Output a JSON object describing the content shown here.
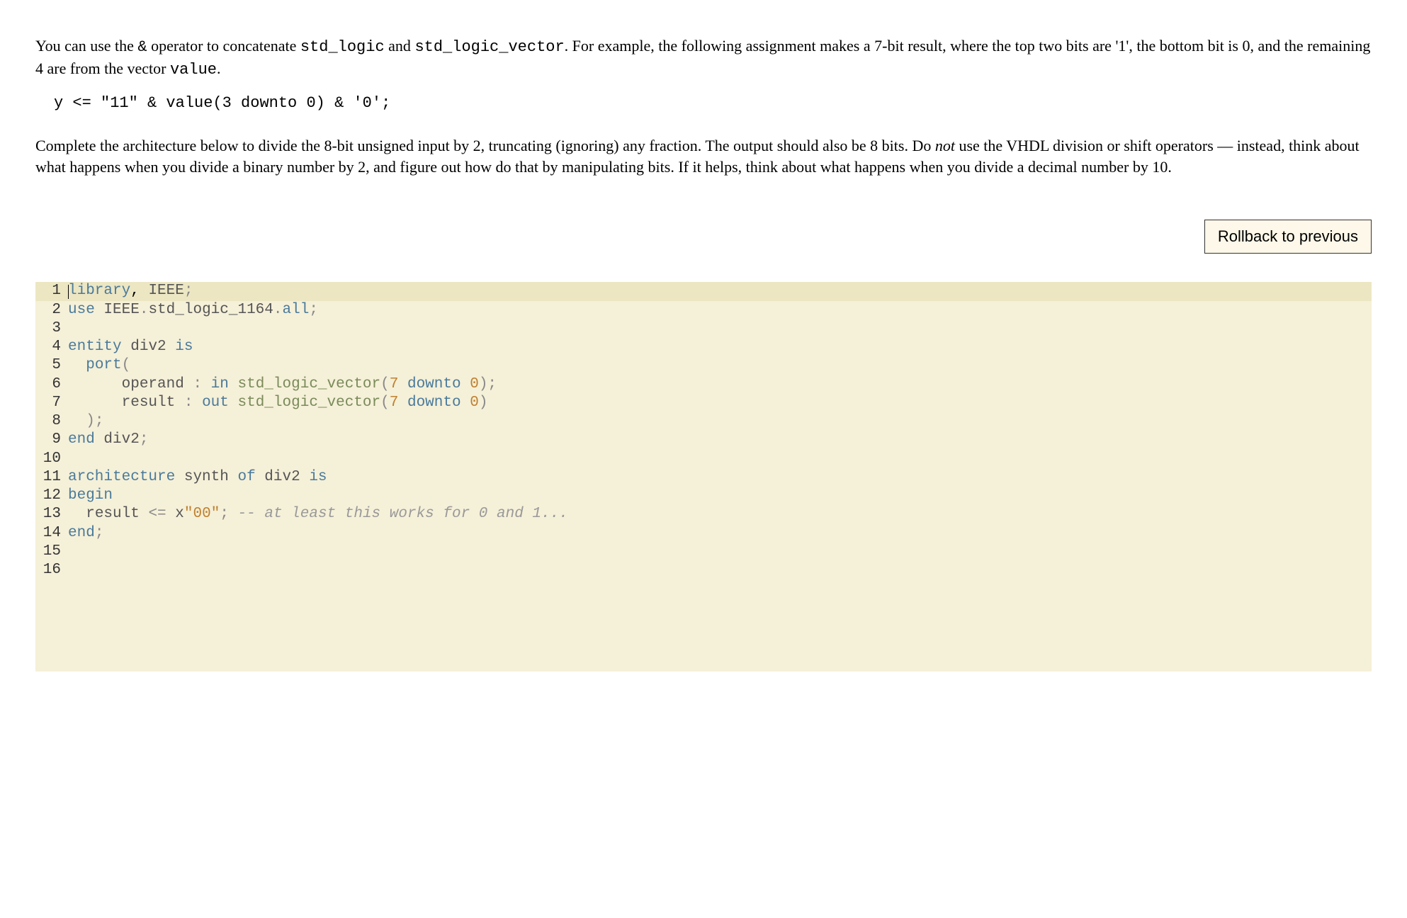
{
  "prose": {
    "para1_part1": "You can use the ",
    "para1_code1": "&",
    "para1_part2": " operator to concatenate ",
    "para1_code2": "std_logic",
    "para1_part3": " and ",
    "para1_code3": "std_logic_vector",
    "para1_part4": ". For example, the following assignment makes a 7-bit result, where the top two bits are '1', the bottom bit is 0, and the remaining 4 are from the vector ",
    "para1_code4": "value",
    "para1_part5": ".",
    "code_block": "y <= \"11\" & value(3 downto 0) & '0';",
    "para2_part1": "Complete the architecture below to divide the 8-bit unsigned input by 2, truncating (ignoring) any fraction. The output should also be 8 bits. Do ",
    "para2_em": "not",
    "para2_part2": " use the VHDL division or shift operators — instead, think about what happens when you divide a binary number by 2, and figure out how do that by manipulating bits. If it helps, think about what happens when you divide a decimal number by 10."
  },
  "button": {
    "rollback": "Rollback to previous"
  },
  "editor": {
    "lines": [
      {
        "n": "1",
        "tokens": [
          [
            "cursor",
            ""
          ],
          [
            "kw",
            "library"
          ],
          [
            "",
            ", "
          ],
          [
            "id",
            "IEEE"
          ],
          [
            "punc",
            ";"
          ]
        ]
      },
      {
        "n": "2",
        "tokens": [
          [
            "kw",
            "use"
          ],
          [
            "",
            " "
          ],
          [
            "id",
            "IEEE"
          ],
          [
            "punc",
            "."
          ],
          [
            "id",
            "std_logic_1164"
          ],
          [
            "punc",
            "."
          ],
          [
            "kw",
            "all"
          ],
          [
            "punc",
            ";"
          ]
        ]
      },
      {
        "n": "3",
        "tokens": [
          [
            "",
            ""
          ]
        ]
      },
      {
        "n": "4",
        "tokens": [
          [
            "kw",
            "entity"
          ],
          [
            "",
            " "
          ],
          [
            "id",
            "div2"
          ],
          [
            "",
            " "
          ],
          [
            "kw",
            "is"
          ]
        ]
      },
      {
        "n": "5",
        "tokens": [
          [
            "",
            "  "
          ],
          [
            "kw",
            "port"
          ],
          [
            "punc",
            "("
          ]
        ]
      },
      {
        "n": "6",
        "tokens": [
          [
            "",
            "      "
          ],
          [
            "id",
            "operand"
          ],
          [
            "",
            " "
          ],
          [
            "punc",
            ":"
          ],
          [
            "",
            " "
          ],
          [
            "kw",
            "in"
          ],
          [
            "",
            " "
          ],
          [
            "typ",
            "std_logic_vector"
          ],
          [
            "punc",
            "("
          ],
          [
            "num",
            "7"
          ],
          [
            "",
            " "
          ],
          [
            "kw",
            "downto"
          ],
          [
            "",
            " "
          ],
          [
            "num",
            "0"
          ],
          [
            "punc",
            ");"
          ]
        ]
      },
      {
        "n": "7",
        "tokens": [
          [
            "",
            "      "
          ],
          [
            "id",
            "result"
          ],
          [
            "",
            " "
          ],
          [
            "punc",
            ":"
          ],
          [
            "",
            " "
          ],
          [
            "kw",
            "out"
          ],
          [
            "",
            " "
          ],
          [
            "typ",
            "std_logic_vector"
          ],
          [
            "punc",
            "("
          ],
          [
            "num",
            "7"
          ],
          [
            "",
            " "
          ],
          [
            "kw",
            "downto"
          ],
          [
            "",
            " "
          ],
          [
            "num",
            "0"
          ],
          [
            "punc",
            ")"
          ]
        ]
      },
      {
        "n": "8",
        "tokens": [
          [
            "",
            "  "
          ],
          [
            "punc",
            ");"
          ]
        ]
      },
      {
        "n": "9",
        "tokens": [
          [
            "kw",
            "end"
          ],
          [
            "",
            " "
          ],
          [
            "id",
            "div2"
          ],
          [
            "punc",
            ";"
          ]
        ]
      },
      {
        "n": "10",
        "tokens": [
          [
            "",
            ""
          ]
        ]
      },
      {
        "n": "11",
        "tokens": [
          [
            "kw",
            "architecture"
          ],
          [
            "",
            " "
          ],
          [
            "id",
            "synth"
          ],
          [
            "",
            " "
          ],
          [
            "kw",
            "of"
          ],
          [
            "",
            " "
          ],
          [
            "id",
            "div2"
          ],
          [
            "",
            " "
          ],
          [
            "kw",
            "is"
          ]
        ]
      },
      {
        "n": "12",
        "tokens": [
          [
            "kw",
            "begin"
          ]
        ]
      },
      {
        "n": "13",
        "tokens": [
          [
            "",
            "  "
          ],
          [
            "id",
            "result"
          ],
          [
            "",
            " "
          ],
          [
            "punc",
            "<="
          ],
          [
            "",
            " "
          ],
          [
            "id",
            "x"
          ],
          [
            "str",
            "\"00\""
          ],
          [
            "punc",
            ";"
          ],
          [
            "",
            " "
          ],
          [
            "cmt",
            "-- at least this works for 0 and 1..."
          ]
        ]
      },
      {
        "n": "14",
        "tokens": [
          [
            "kw",
            "end"
          ],
          [
            "punc",
            ";"
          ]
        ]
      },
      {
        "n": "15",
        "tokens": [
          [
            "",
            ""
          ]
        ]
      },
      {
        "n": "16",
        "tokens": [
          [
            "",
            ""
          ]
        ]
      }
    ]
  }
}
